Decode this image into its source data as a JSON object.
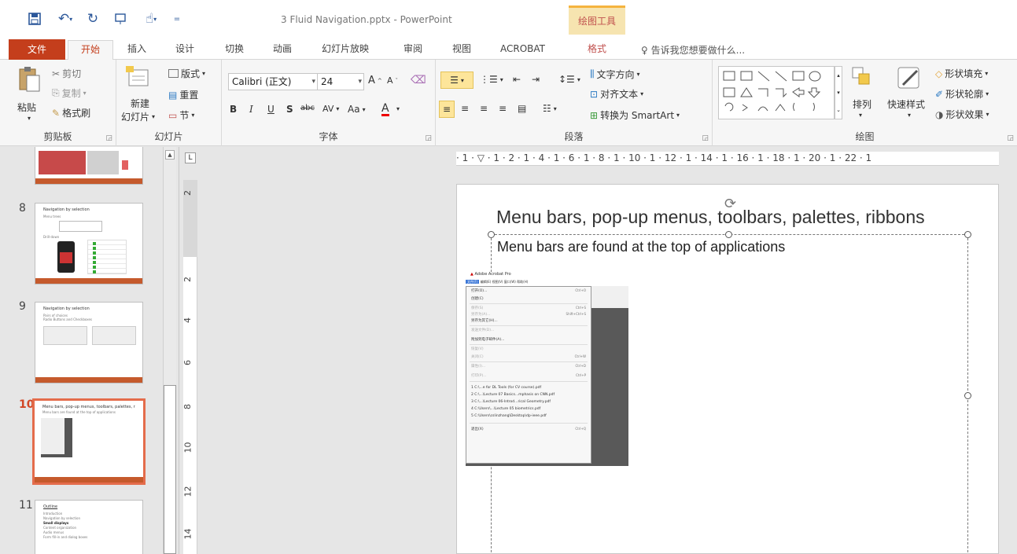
{
  "window": {
    "title": "3 Fluid Navigation.pptx - PowerPoint",
    "context_group": "绘图工具"
  },
  "tabs": [
    {
      "label": "文件"
    },
    {
      "label": "开始"
    },
    {
      "label": "插入"
    },
    {
      "label": "设计"
    },
    {
      "label": "切换"
    },
    {
      "label": "动画"
    },
    {
      "label": "幻灯片放映"
    },
    {
      "label": "审阅"
    },
    {
      "label": "视图"
    },
    {
      "label": "ACROBAT"
    },
    {
      "label": "格式"
    }
  ],
  "tell_me": "告诉我您想要做什么...",
  "ribbon": {
    "clipboard": {
      "label": "剪贴板",
      "paste": "粘贴",
      "cut": "剪切",
      "copy": "复制",
      "format_painter": "格式刷"
    },
    "slides": {
      "label": "幻灯片",
      "new_slide": "新建",
      "new_slide2": "幻灯片",
      "layout": "版式",
      "reset": "重置",
      "section": "节"
    },
    "font": {
      "label": "字体",
      "font_name": "Calibri (正文)",
      "font_size": "24",
      "aa": "Aa"
    },
    "paragraph": {
      "label": "段落",
      "text_direction": "文字方向",
      "align_text": "对齐文本",
      "convert_smartart": "转换为 SmartArt"
    },
    "drawing": {
      "label": "绘图",
      "arrange": "排列",
      "quick_styles": "快速样式",
      "shape_fill": "形状填充",
      "shape_outline": "形状轮廓",
      "shape_effects": "形状效果"
    }
  },
  "thumbnails": [
    {
      "num": "8",
      "title": "Navigation by selection",
      "line1": "Menu trees",
      "line2": "Drill-down"
    },
    {
      "num": "9",
      "title": "Navigation by selection",
      "line1": "Pairs of choices",
      "line2": "Radio Buttons and Checkboxes"
    },
    {
      "num": "10",
      "title": "Menu bars, pop-up menus, toolbars, palettes, ribbons",
      "line1": "Menu bars are found at the top of applications"
    },
    {
      "num": "11",
      "title": "Outline",
      "line1": "Introduction",
      "line2": "Navigation by selection",
      "line3": "Small displays",
      "line4": "Content organization",
      "line5": "Audio menus",
      "line6": "Form fill-in and dialog boxes"
    }
  ],
  "vruler": [
    "2",
    "2",
    "4",
    "6",
    "8",
    "10",
    "12",
    "14"
  ],
  "hruler": "· 1 · ▽ · 1 · 2 · 1 · 4 · 1 · 6 · 1 · 8 · 1 · 10 · 1 · 12 · 1 · 14 · 1 · 16 · 1 · 18 · 1 · 20 · 1 · 22 · 1",
  "ruler_corner": "L",
  "slide": {
    "title": "Menu bars, pop-up menus, toolbars, palettes, ribbons",
    "body": "Menu bars are found at the top of applications"
  },
  "embedded": {
    "app_title": "Adobe Acrobat Pro",
    "menu": [
      "文件(F)",
      "编辑(E)",
      "视图(V)",
      "窗口(W)",
      "帮助(H)"
    ],
    "items": [
      {
        "label": "打开(O)...",
        "shortcut": "Ctrl+O",
        "grey": false
      },
      {
        "label": "创建(C)",
        "shortcut": "",
        "grey": false
      },
      {
        "label": "保存(S)",
        "shortcut": "Ctrl+S",
        "grey": true
      },
      {
        "label": "另存为(A)...",
        "shortcut": "Shift+Ctrl+S",
        "grey": true
      },
      {
        "label": "另存为其它(H)...",
        "shortcut": "",
        "grey": false
      },
      {
        "label": "发送文件(D)...",
        "shortcut": "",
        "grey": true
      },
      {
        "label": "附加到电子邮件(A)...",
        "shortcut": "",
        "grey": false
      },
      {
        "label": "恢复(V)",
        "shortcut": "",
        "grey": true
      },
      {
        "label": "关闭(C)",
        "shortcut": "Ctrl+W",
        "grey": true
      },
      {
        "label": "属性(I)...",
        "shortcut": "Ctrl+D",
        "grey": true
      },
      {
        "label": "打印(P)...",
        "shortcut": "Ctrl+P",
        "grey": true
      },
      {
        "label": "1 C:\\...e for DL Tools (for CV course).pdf",
        "shortcut": "",
        "grey": false
      },
      {
        "label": "2 C:\\...\\Lecture 07 Basics...mphasis on CNN.pdf",
        "shortcut": "",
        "grey": false
      },
      {
        "label": "3 C:\\...\\Lecture 06-Introd...rical Geometry.pdf",
        "shortcut": "",
        "grey": false
      },
      {
        "label": "4 C:\\Users\\...\\Lecture 05 biometrics.pdf",
        "shortcut": "",
        "grey": false
      },
      {
        "label": "5 C:\\Users\\cslinzhang\\Desktop\\dp-ieee.pdf",
        "shortcut": "",
        "grey": false
      },
      {
        "label": "退出(X)",
        "shortcut": "Ctrl+Q",
        "grey": false
      }
    ]
  }
}
